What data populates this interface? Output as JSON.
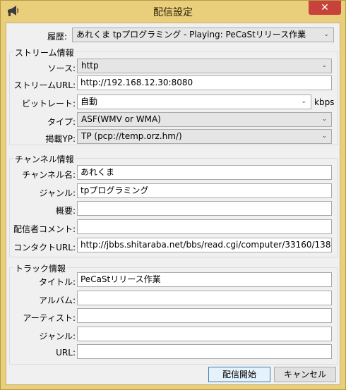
{
  "window": {
    "title": "配信設定",
    "close_glyph": "✕"
  },
  "history": {
    "label": "履歴:",
    "value": "あれくま tpプログラミング  -  Playing: PeCaStリリース作業"
  },
  "stream": {
    "group_title": "ストリーム情報",
    "source_label": "ソース:",
    "source_value": "http",
    "url_label": "ストリームURL:",
    "url_value": "http://192.168.12.30:8080",
    "bitrate_label": "ビットレート:",
    "bitrate_value": "自動",
    "bitrate_unit": "kbps",
    "type_label": "タイプ:",
    "type_value": "ASF(WMV or WMA)",
    "yp_label": "掲載YP:",
    "yp_value": "TP (pcp://temp.orz.hm/)"
  },
  "channel": {
    "group_title": "チャンネル情報",
    "name_label": "チャンネル名:",
    "name_value": "あれくま",
    "genre_label": "ジャンル:",
    "genre_value": "tpプログラミング",
    "desc_label": "概要:",
    "desc_value": "",
    "comment_label": "配信者コメント:",
    "comment_value": "",
    "contact_label": "コンタクトURL:",
    "contact_value": "http://jbbs.shitaraba.net/bbs/read.cgi/computer/33160/138"
  },
  "track": {
    "group_title": "トラック情報",
    "title_label": "タイトル:",
    "title_value": "PeCaStリリース作業",
    "album_label": "アルバム:",
    "album_value": "",
    "artist_label": "アーティスト:",
    "artist_value": "",
    "genre_label": "ジャンル:",
    "genre_value": "",
    "url_label": "URL:",
    "url_value": ""
  },
  "buttons": {
    "start_label": "配信開始",
    "cancel_label": "キャンセル"
  },
  "icons": {
    "app": "megaphone-icon",
    "dropdown": "chevron-down-icon"
  }
}
